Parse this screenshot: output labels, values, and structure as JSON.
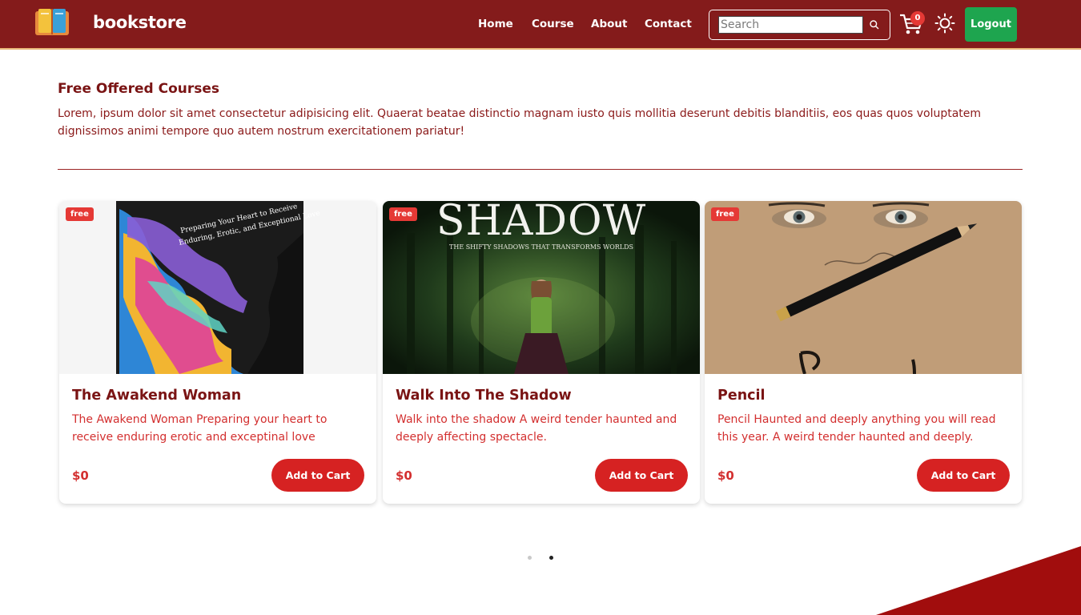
{
  "brand": {
    "name": "bookstore"
  },
  "nav": {
    "links": [
      "Home",
      "Course",
      "About",
      "Contact"
    ],
    "search_placeholder": "Search",
    "cart_count": "0",
    "logout_label": "Logout"
  },
  "section": {
    "title": "Free Offered Courses",
    "description": "Lorem, ipsum dolor sit amet consectetur adipisicing elit. Quaerat beatae distinctio magnam iusto quis mollitia deserunt debitis blanditiis, eos quas quos voluptatem dignissimos animi tempore quo autem nostrum exercitationem pariatur!"
  },
  "cards": [
    {
      "badge": "free",
      "cover_lines": [
        "Preparing Your Heart to Receive",
        "Enduring, Erotic, and Exceptional Love"
      ],
      "title": "The Awakend Woman",
      "description": "The Awakend Woman Preparing your heart to receive enduring erotic and exceptinal love",
      "price": "$0",
      "button": "Add to Cart"
    },
    {
      "badge": "free",
      "cover_title": "SHADOW",
      "cover_subtitle": "THE SHIFTY SHADOWS THAT TRANSFORMS WORLDS",
      "title": "Walk Into The Shadow",
      "description": "Walk into the shadow A weird tender haunted and deeply affecting spectacle.",
      "price": "$0",
      "button": "Add to Cart"
    },
    {
      "badge": "free",
      "title": "Pencil",
      "description": "Pencil Haunted and deeply anything you will read this year. A weird tender haunted and deeply.",
      "price": "$0",
      "button": "Add to Cart"
    }
  ],
  "carousel": {
    "active_index": 1,
    "dots": 2
  },
  "colors": {
    "navbar": "#841b1b",
    "accent": "#d62222",
    "title": "#7a1414",
    "logout": "#1ea54f"
  }
}
